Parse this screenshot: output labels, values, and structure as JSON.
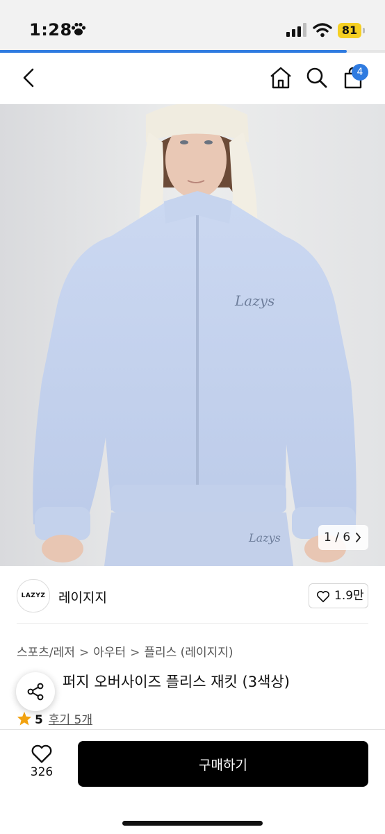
{
  "status_bar": {
    "time": "1:28",
    "battery": "81",
    "battery_color": "#f5cf22"
  },
  "page_load_progress": 0.9,
  "header": {
    "cart_count": "4",
    "accent": "#2f7be0"
  },
  "gallery": {
    "counter": "1 / 6",
    "garment_logo": "Lazys"
  },
  "brand": {
    "logo_text": "LAZYZ",
    "name": "레이지지",
    "likes": "1.9만"
  },
  "breadcrumb": [
    "스포츠/레저",
    "아우터",
    "플리스 (레이지지)"
  ],
  "product": {
    "title": "퍼지 오버사이즈 플리스 재킷 (3색상)",
    "rating": "5",
    "reviews_label": "후기 5개"
  },
  "bottom_bar": {
    "wish_count": "326",
    "buy_label": "구매하기"
  },
  "icons": [
    "paw-icon",
    "signal-icon",
    "wifi-icon",
    "back-icon",
    "home-icon",
    "search-icon",
    "cart-icon",
    "chevron-right-icon",
    "heart-icon",
    "share-icon",
    "star-icon"
  ]
}
